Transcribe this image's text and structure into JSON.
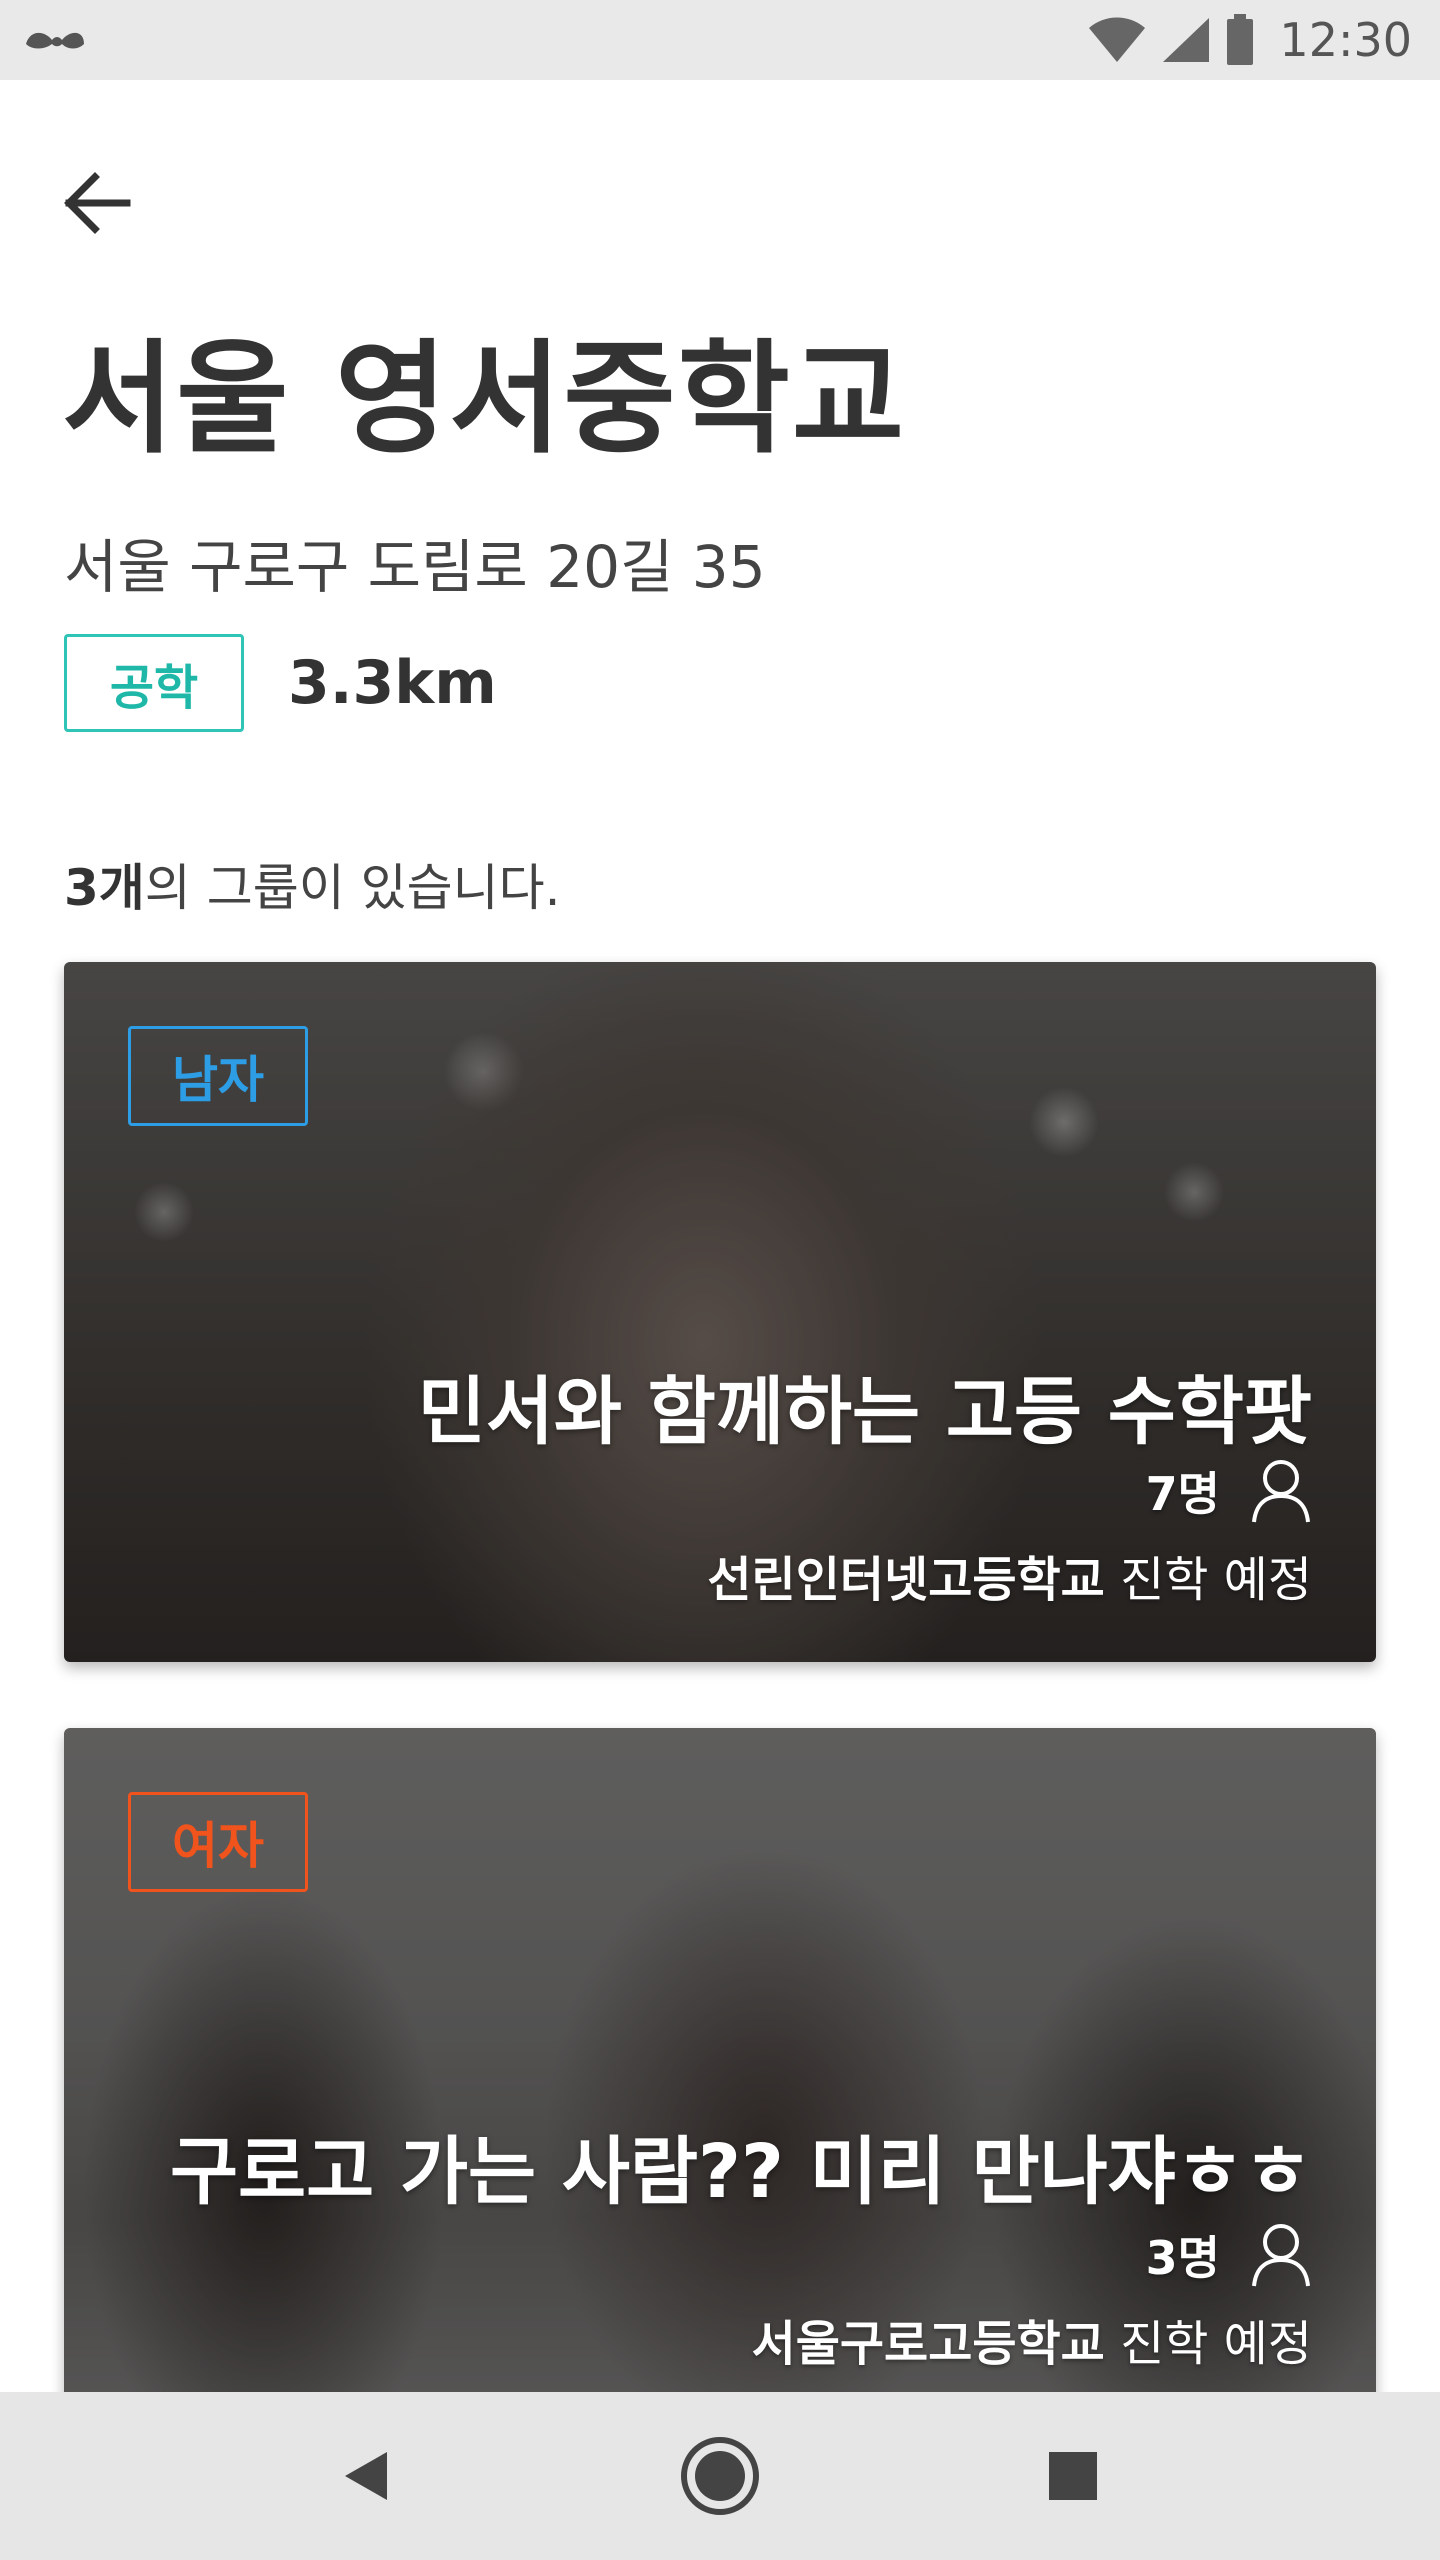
{
  "status_bar": {
    "time": "12:30",
    "icons": [
      "mustache-icon",
      "wifi-icon",
      "signal-icon",
      "battery-icon"
    ]
  },
  "header": {
    "back_icon": "arrow-left-icon",
    "school_name": "서울 영서중학교",
    "address": "서울 구로구 도림로 20길 35",
    "school_type": "공학",
    "distance": "3.3km"
  },
  "groups_summary": {
    "count": "3개",
    "suffix": "의 그룹이 있습니다."
  },
  "groups": [
    {
      "gender": "남자",
      "title": "민서와 함께하는 고등 수학팟",
      "members": "7명",
      "destination_school": "선린인터넷고등학교",
      "destination_suffix": " 진학 예정"
    },
    {
      "gender": "여자",
      "title": "구로고 가는 사람?? 미리 만나쟈ㅎㅎ",
      "members": "3명",
      "destination_school": "서울구로고등학교",
      "destination_suffix": " 진학 예정"
    }
  ],
  "colors": {
    "coed_tag": "#2ec4b6",
    "male_tag": "#2d9ee6",
    "female_tag": "#f0531c"
  },
  "nav_bar": {
    "icons": [
      "back-triangle-icon",
      "home-circle-icon",
      "recents-square-icon"
    ]
  }
}
